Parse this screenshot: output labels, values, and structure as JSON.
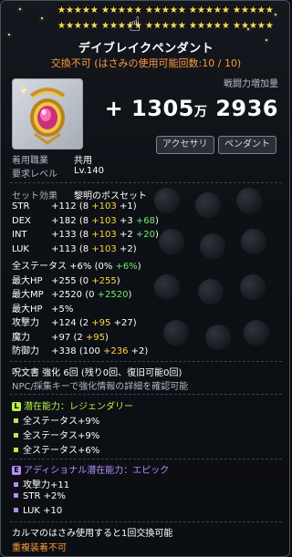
{
  "item": {
    "stars": "★★★★★  ★★★★★  ★★★★★  ★★★★★  ★★★★★",
    "name": "デイブレイクペンダント",
    "trade": "交換不可 (はさみの使用可能回数:10 / 10)",
    "cp_label": "戦闘力増加量",
    "cp_value_main": "+ 1305",
    "cp_unit": "万",
    "cp_value_tail": "2936",
    "tags": [
      "アクセサリ",
      "ペンダント"
    ]
  },
  "req": {
    "job_label": "着用職業",
    "job_value": "共用",
    "level_label": "要求レベル",
    "level_value": "Lv.140"
  },
  "set": {
    "label": "セット効果",
    "value": "黎明のボスセット"
  },
  "stats": [
    {
      "name": "STR",
      "total": "+112",
      "base": "8",
      "a": "+103",
      "b": "+1",
      "b_color": "white",
      "c": ""
    },
    {
      "name": "DEX",
      "total": "+182",
      "base": "8",
      "a": "+103",
      "b": "+3",
      "b_color": "white",
      "c": "+68"
    },
    {
      "name": "INT",
      "total": "+133",
      "base": "8",
      "a": "+103",
      "b": "+2",
      "b_color": "white",
      "c": "+20"
    },
    {
      "name": "LUK",
      "total": "+113",
      "base": "8",
      "a": "+103",
      "b": "+2",
      "b_color": "white",
      "c": ""
    },
    {
      "name": "全ステータス",
      "total": "+6%",
      "base": "0%",
      "a": "",
      "b": "+6%",
      "b_color": "green",
      "c": ""
    },
    {
      "name": "最大HP",
      "total": "+255",
      "base": "0",
      "a": "+255",
      "b": "",
      "b_color": "white",
      "c": ""
    },
    {
      "name": "最大MP",
      "total": "+2520",
      "base": "0",
      "a": "",
      "b": "+2520",
      "b_color": "green",
      "c": ""
    },
    {
      "name": "最大HP",
      "total": "+5%",
      "base": "",
      "a": "",
      "b": "",
      "b_color": "white",
      "c": ""
    },
    {
      "name": "攻撃力",
      "total": "+124",
      "base": "2",
      "a": "+95",
      "b": "+27",
      "b_color": "white",
      "c": ""
    },
    {
      "name": "魔力",
      "total": "+97",
      "base": "2",
      "a": "+95",
      "b": "",
      "b_color": "white",
      "c": ""
    },
    {
      "name": "防御力",
      "total": "+338",
      "base": "100",
      "a": "+236",
      "b": "+2",
      "b_color": "white",
      "c": ""
    }
  ],
  "scroll_line": "呪文書 強化 6回 (残り0回、復旧可能0回)",
  "npc_line": "NPC/採集キーで強化情報の詳細を確認可能",
  "potential": {
    "badge": "L",
    "title": "潜在能力：レジェンダリー",
    "color": "#b7f04a",
    "lines": [
      "全ステータス+9%",
      "全ステータス+9%",
      "全ステータス+6%"
    ]
  },
  "additional": {
    "badge": "E",
    "title": "アディショナル潜在能力：エピック",
    "color": "#b58cff",
    "lines": [
      "攻撃力+11",
      "STR +2%",
      "LUK +10"
    ]
  },
  "footer1": "カルマのはさみ使用すると1回交換可能",
  "footer2": "重複装着不可"
}
